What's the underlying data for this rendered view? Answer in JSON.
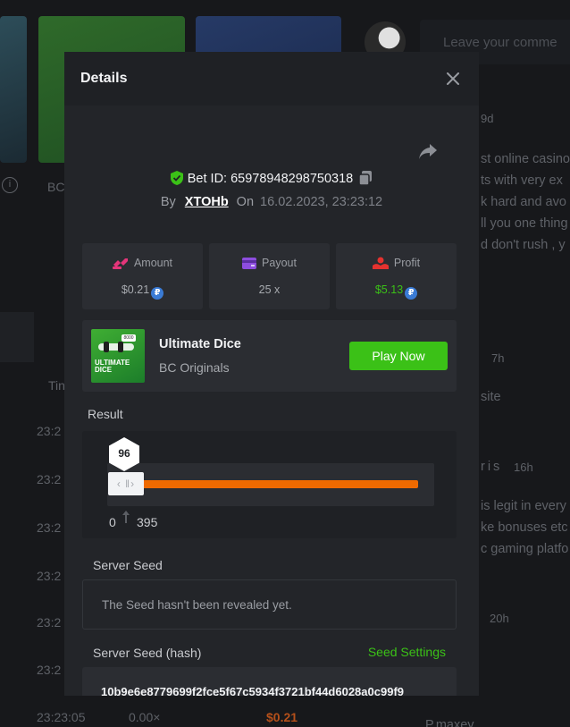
{
  "background": {
    "sidebar_letters": "BC",
    "table_header_fragment": "Tin",
    "times": [
      "23:2",
      "23:2",
      "23:2",
      "23:2",
      "23:2",
      "23:2",
      "23:2"
    ],
    "bottom_row": {
      "time": "23:23:05",
      "multiplier": "0.00×",
      "amount": "$0.21"
    },
    "comment_placeholder": "Leave your comme",
    "comments": {
      "c1_time": "9d",
      "c1_lines": [
        "st online casino",
        "ts with very ex",
        "k hard and avo",
        "ll you one thing",
        "d don't rush , y"
      ],
      "c2_time": "7h",
      "c2_line": "site",
      "c3_name": "ris",
      "c3_time": "16h",
      "c3_lines": [
        "is legit in every",
        "ke bonuses etc",
        "c gaming platfo"
      ],
      "c4_time": "20h",
      "c5_name": "P.maxey"
    }
  },
  "modal": {
    "title": "Details",
    "bet_id_label": "Bet ID: 65978948298750318",
    "by_label": "By",
    "username": "XTOHb",
    "on_label": "On",
    "datetime": "16.02.2023, 23:23:12",
    "stats": {
      "amount": {
        "label": "Amount",
        "value": "$0.21"
      },
      "payout": {
        "label": "Payout",
        "value": "25 x"
      },
      "profit": {
        "label": "Profit",
        "value": "$5.13"
      }
    },
    "coin_symbol": "₽",
    "game": {
      "name": "Ultimate Dice",
      "provider": "BC Originals",
      "thumb_title_1": "ULTIMATE",
      "thumb_title_2": "DICE",
      "thumb_badge": "8000",
      "play_label": "Play Now"
    },
    "result": {
      "label": "Result",
      "value": "96",
      "range_min": "0",
      "range_max": "395",
      "handle_glyph": "‹ ǁ›"
    },
    "server_seed": {
      "label": "Server Seed",
      "value": "The Seed hasn't been revealed yet."
    },
    "server_seed_hash": {
      "label": "Server Seed (hash)",
      "settings_label": "Seed Settings",
      "value": "10b9e6e8779699f2fce5f67c5934f3721bf44d6028a0c99f9"
    }
  },
  "colors": {
    "accent_green": "#3bc117",
    "slider_orange": "#ef6a00",
    "modal_bg": "#232529",
    "coin_blue": "#3a7bd5"
  }
}
